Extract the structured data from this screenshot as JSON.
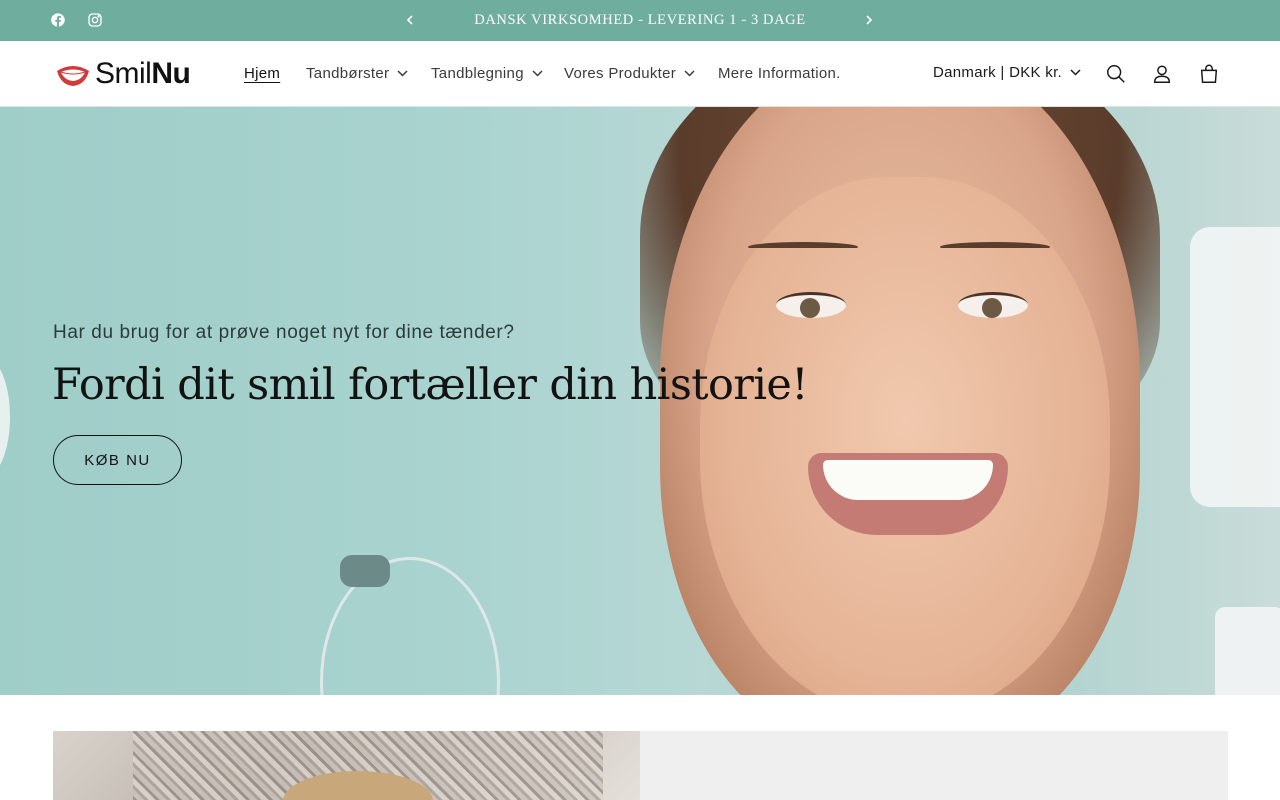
{
  "announcement": {
    "text": "DANSK VIRKSOMHED - LEVERING 1 - 3 DAGE",
    "prev_icon": "chevron-left-icon",
    "next_icon": "chevron-right-icon"
  },
  "social": [
    {
      "name": "facebook",
      "icon": "facebook-icon"
    },
    {
      "name": "instagram",
      "icon": "instagram-icon"
    }
  ],
  "header": {
    "logo": {
      "text_regular": "Smil",
      "text_bold": "Nu"
    },
    "nav": [
      {
        "label": "Hjem",
        "active": true
      },
      {
        "label": "Tandbørster",
        "has_dropdown": true
      },
      {
        "label": "Tandblegning",
        "has_dropdown": true
      },
      {
        "label": "Vores Produkter",
        "has_dropdown": true
      },
      {
        "label": "Mere Information."
      }
    ],
    "country_selector": "Danmark | DKK kr.",
    "icons": [
      "search-icon",
      "account-icon",
      "cart-icon"
    ]
  },
  "hero": {
    "subheading": "Har du brug for at prøve noget nyt for dine tænder?",
    "heading": "Fordi dit smil fortæller din historie!",
    "button_label": "KØB NU"
  },
  "colors": {
    "announcement_bg": "#6fae9f",
    "hero_bg": "#a9d3cf",
    "text": "#121212"
  }
}
